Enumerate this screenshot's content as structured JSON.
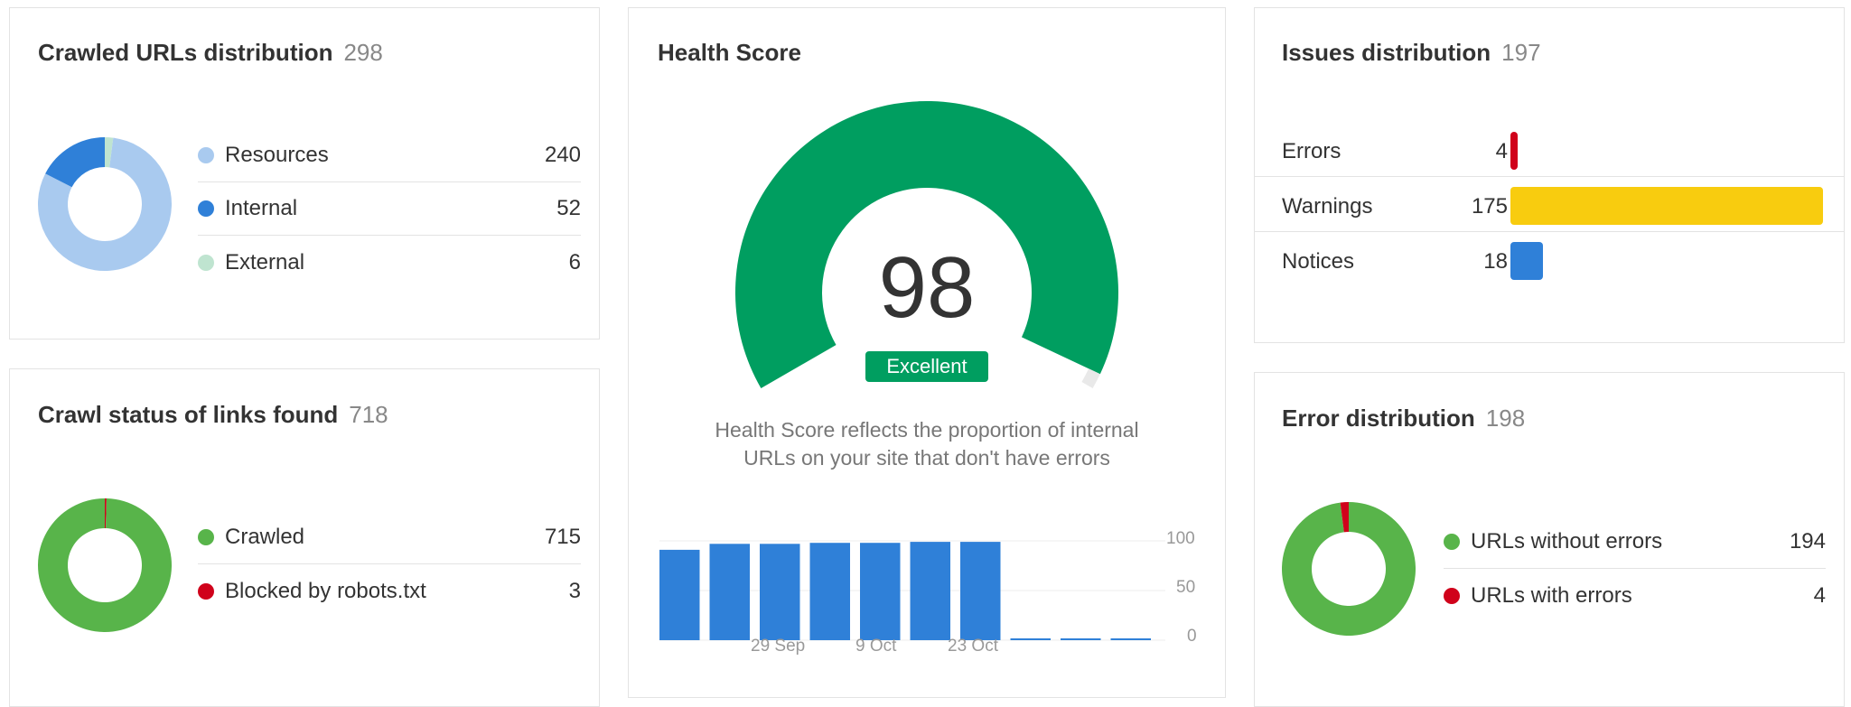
{
  "colors": {
    "resources": "#a9caef",
    "internal": "#2f80d8",
    "external": "#bfe4d0",
    "crawled": "#58b44a",
    "blocked": "#d0021b",
    "health_green": "#009e60",
    "health_rest": "#e9e9e9",
    "errors_bar": "#d0021b",
    "warnings_bar": "#f8cc0f",
    "notices_bar": "#2f80d8",
    "history_bar": "#2f80d8"
  },
  "crawled_urls": {
    "title": "Crawled URLs distribution",
    "count": "298",
    "items": [
      {
        "label": "Resources",
        "value": "240",
        "num": 240,
        "color": "#a9caef"
      },
      {
        "label": "Internal",
        "value": "52",
        "num": 52,
        "color": "#2f80d8"
      },
      {
        "label": "External",
        "value": "6",
        "num": 6,
        "color": "#bfe4d0"
      }
    ]
  },
  "crawl_status": {
    "title": "Crawl status of links found",
    "count": "718",
    "items": [
      {
        "label": "Crawled",
        "value": "715",
        "num": 715,
        "color": "#58b44a"
      },
      {
        "label": "Blocked by robots.txt",
        "value": "3",
        "num": 3,
        "color": "#d0021b"
      }
    ]
  },
  "health": {
    "title": "Health Score",
    "score": "98",
    "score_num": 98,
    "badge": "Excellent",
    "description_line1": "Health Score reflects the proportion of internal",
    "description_line2": "URLs on your site that don't have errors",
    "y_ticks": [
      "100",
      "50",
      "0"
    ],
    "x_labels": [
      "29 Sep",
      "9 Oct",
      "23 Oct"
    ],
    "history": [
      91,
      97,
      97,
      98,
      98,
      99,
      99,
      1,
      1,
      1
    ],
    "ymax": 100
  },
  "issues": {
    "title": "Issues distribution",
    "count": "197",
    "items": [
      {
        "label": "Errors",
        "value": "4",
        "num": 4,
        "color": "#d0021b"
      },
      {
        "label": "Warnings",
        "value": "175",
        "num": 175,
        "color": "#f8cc0f"
      },
      {
        "label": "Notices",
        "value": "18",
        "num": 18,
        "color": "#2f80d8"
      }
    ]
  },
  "error_distribution": {
    "title": "Error distribution",
    "count": "198",
    "items": [
      {
        "label": "URLs without errors",
        "value": "194",
        "num": 194,
        "color": "#58b44a"
      },
      {
        "label": "URLs with errors",
        "value": "4",
        "num": 4,
        "color": "#d0021b"
      }
    ]
  }
}
